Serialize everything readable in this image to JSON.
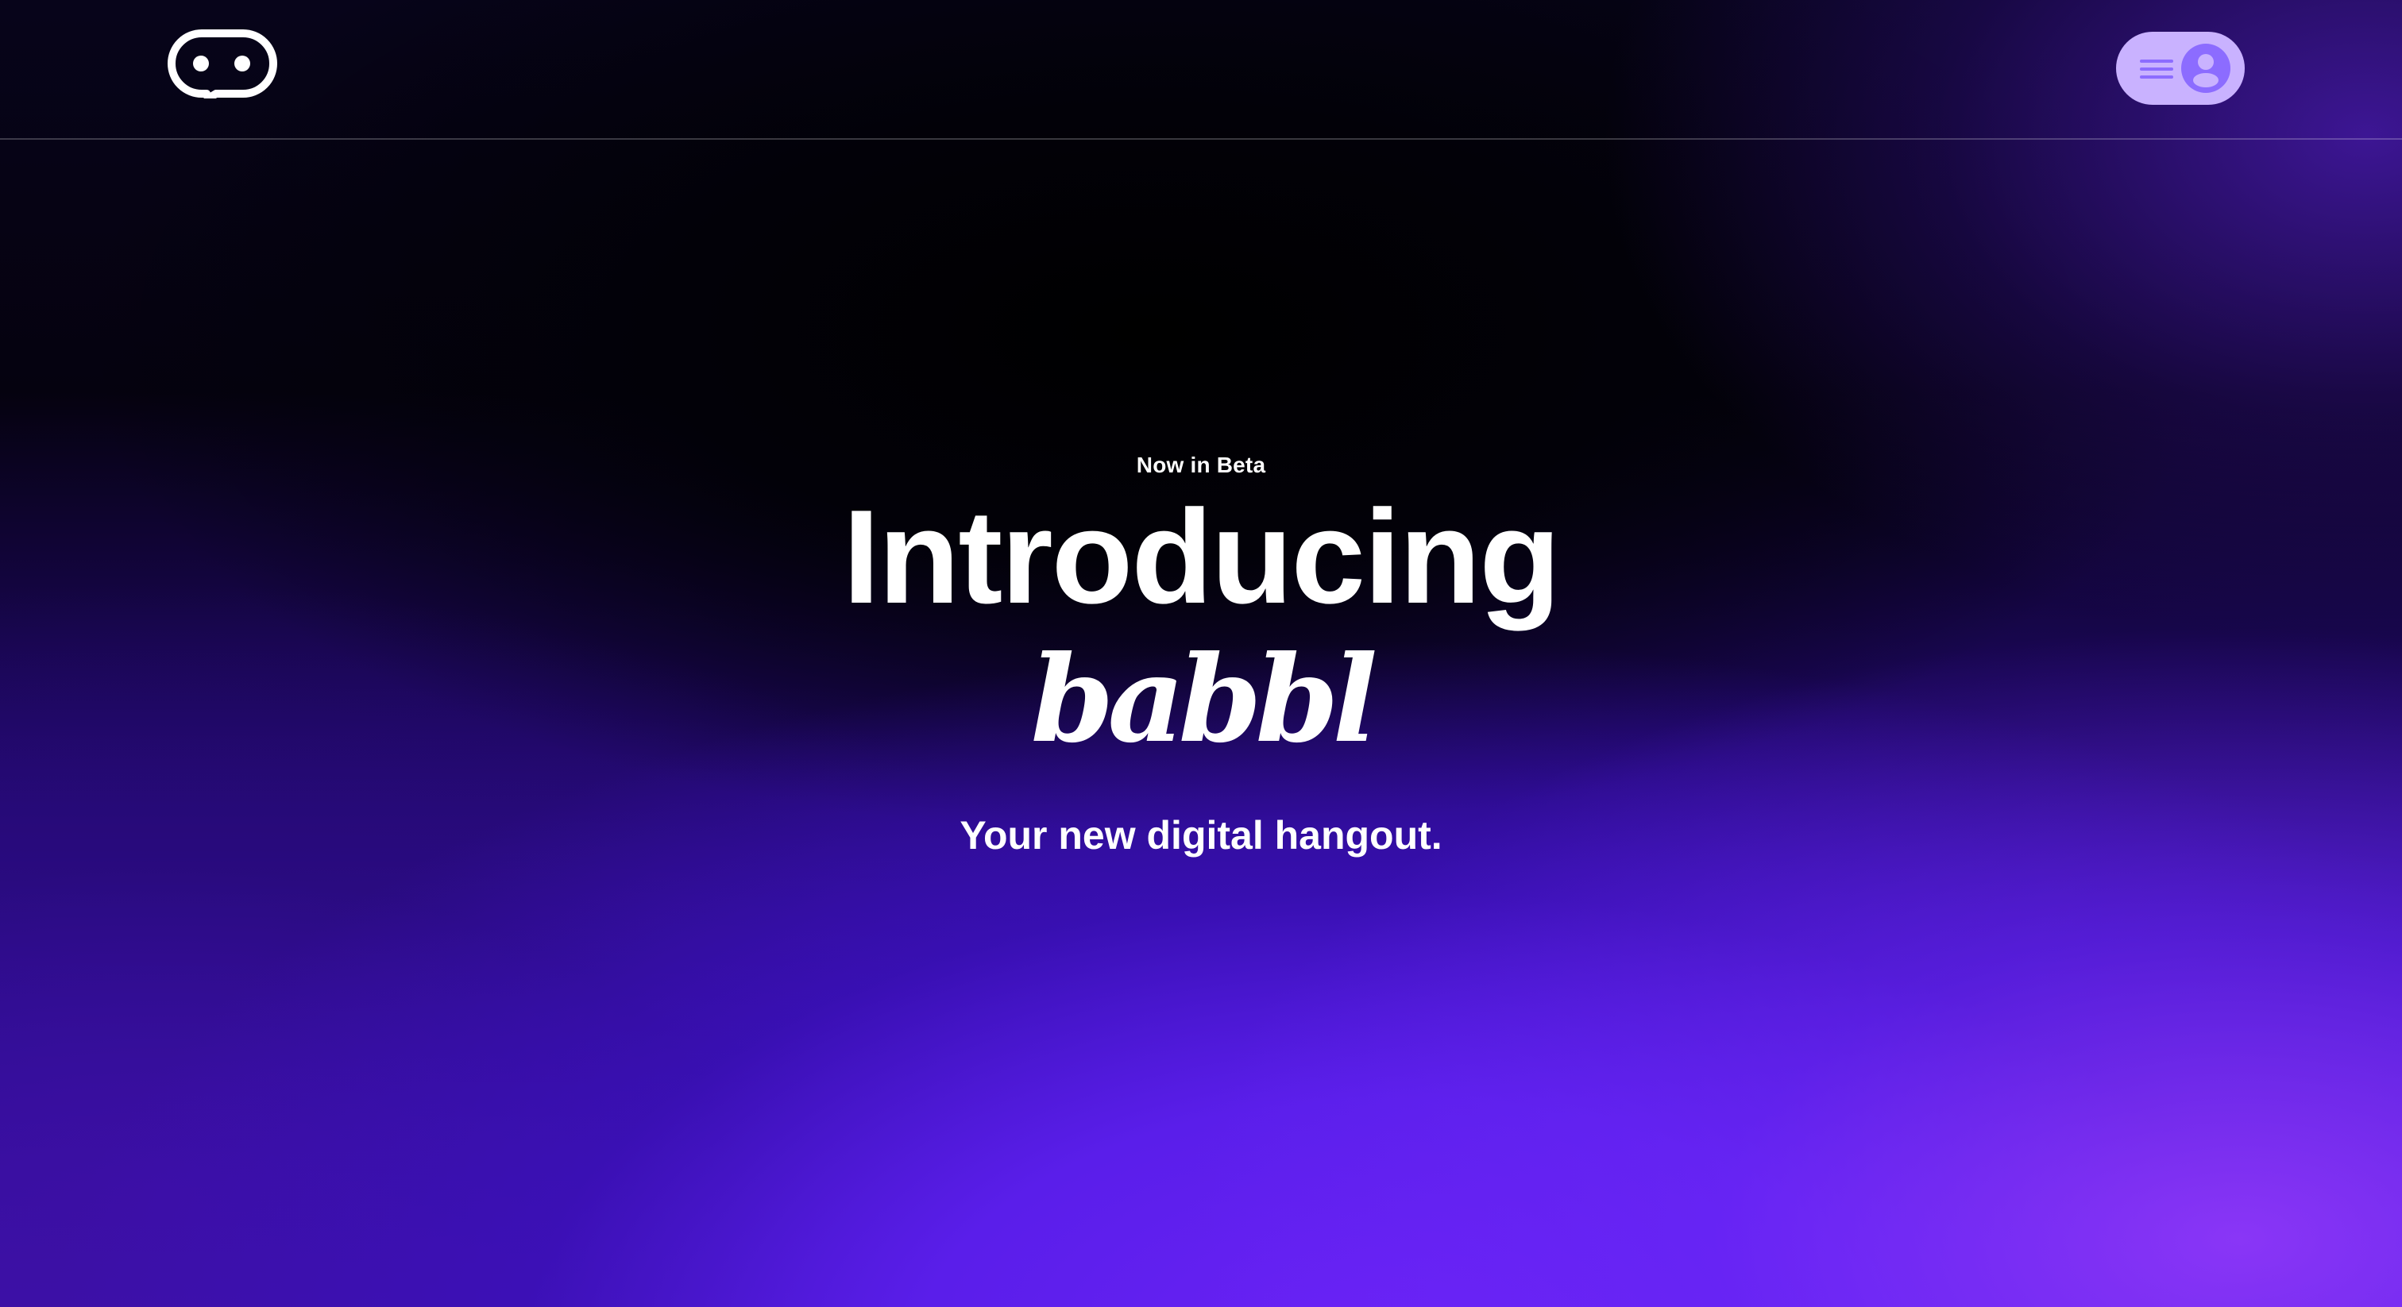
{
  "header": {
    "logo_icon": "chat-bubble-eyes-logo",
    "menu_icon": "hamburger-icon",
    "profile_icon": "user-avatar-icon"
  },
  "hero": {
    "eyebrow": "Now in Beta",
    "headline": "Introducing",
    "brand": "babbl",
    "tagline": "Your new digital hangout."
  },
  "colors": {
    "menu_pill": "#c9b2ff",
    "menu_icon": "#8c6cff",
    "accent_violet": "#6a22f6",
    "text": "#ffffff"
  }
}
